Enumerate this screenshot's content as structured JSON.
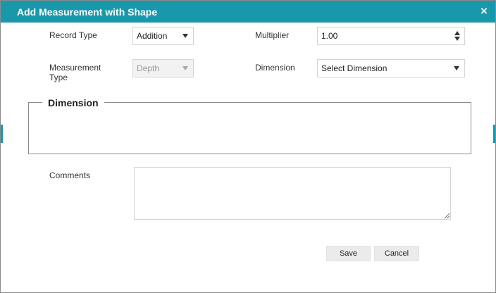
{
  "dialog": {
    "title": "Add Measurement with Shape",
    "close_glyph": "×"
  },
  "fields": {
    "record_type": {
      "label": "Record Type",
      "value": "Addition"
    },
    "multiplier": {
      "label": "Multiplier",
      "value": "1.00"
    },
    "measurement_type": {
      "label": "Measurement Type",
      "value": "Depth"
    },
    "dimension": {
      "label": "Dimension",
      "value": "Select Dimension"
    }
  },
  "dimension_group": {
    "legend": "Dimension"
  },
  "comments": {
    "label": "Comments",
    "value": ""
  },
  "buttons": {
    "save": "Save",
    "cancel": "Cancel"
  },
  "colors": {
    "accent": "#1a98ab",
    "border": "#d4d4d4",
    "button_bg": "#ebebeb"
  }
}
